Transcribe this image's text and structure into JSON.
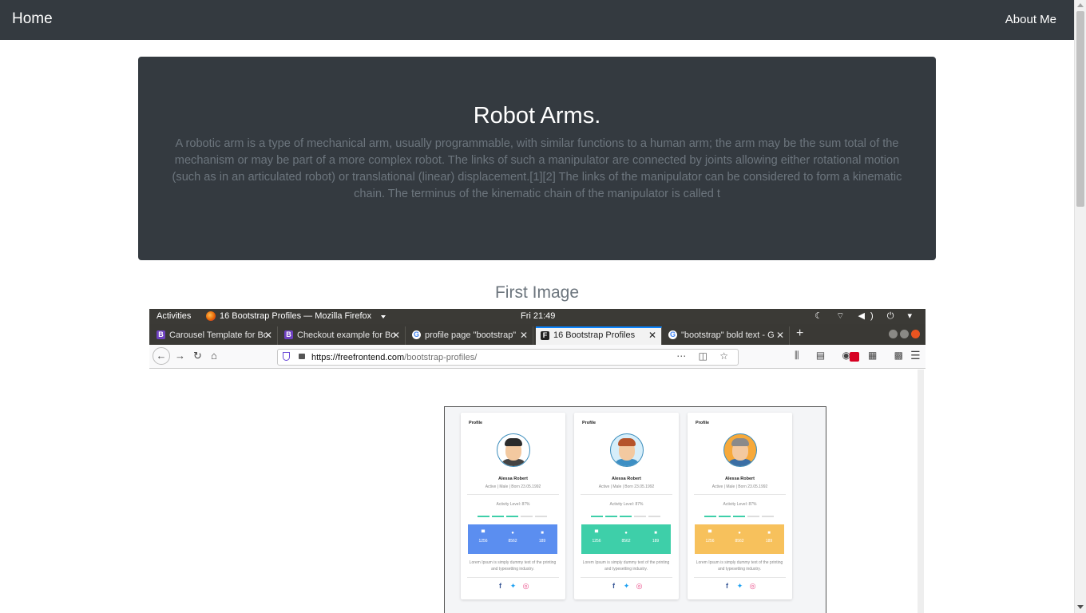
{
  "nav": {
    "home": "Home",
    "about": "About Me"
  },
  "jumbotron": {
    "title": "Robot Arms.",
    "text": "A robotic arm is a type of mechanical arm, usually programmable, with similar functions to a human arm; the arm may be the sum total of the mechanism or may be part of a more complex robot. The links of such a manipulator are connected by joints allowing either rotational motion (such as in an articulated robot) or translational (linear) displacement.[1][2] The links of the manipulator can be considered to form a kinematic chain. The terminus of the kinematic chain of the manipulator is called t"
  },
  "section": {
    "title": "First Image"
  },
  "screenshot": {
    "gnome": {
      "activities": "Activities",
      "app_title": "16 Bootstrap Profiles — Mozilla Firefox",
      "clock": "Fri 21:49"
    },
    "tabs": [
      {
        "label": "Carousel Template for Bo",
        "favicon": "B"
      },
      {
        "label": "Checkout example for Bo",
        "favicon": "B"
      },
      {
        "label": "profile page \"bootstrap\"",
        "favicon": "G"
      },
      {
        "label": "16 Bootstrap Profiles",
        "favicon": "F"
      },
      {
        "label": "\"bootstrap\" bold text - G",
        "favicon": "G"
      }
    ],
    "url": {
      "host": "https://freefrontend.com",
      "path": "/bootstrap-profiles/"
    },
    "cards": [
      {
        "label": "Profile",
        "name": "Alessa Robert",
        "sub": "Active | Male | Born 23.05.1992",
        "level": "Activity Level: 87%",
        "stats": [
          "1256",
          "8562",
          "189"
        ],
        "desc": "Lorem Ipsum is simply dummy text of the printing and typesetting industry.",
        "accent": "#5b8ef0",
        "hair": "#2b2b2b",
        "shirt": "#444"
      },
      {
        "label": "Profile",
        "name": "Alessa Robert",
        "sub": "Active | Male | Born 23.05.1992",
        "level": "Activity Level: 87%",
        "stats": [
          "1256",
          "8562",
          "189"
        ],
        "desc": "Lorem Ipsum is simply dummy text of the printing and typesetting industry.",
        "accent": "#3ecfa9",
        "hair": "#b5532a",
        "shirt": "#3d8fc4"
      },
      {
        "label": "Profile",
        "name": "Alessa Robert",
        "sub": "Active | Male | Born 23.05.1992",
        "level": "Activity Level: 87%",
        "stats": [
          "1256",
          "8562",
          "189"
        ],
        "desc": "Lorem Ipsum is simply dummy text of the printing and typesetting industry.",
        "accent": "#f7c15c",
        "hair": "#8a8a8a",
        "shirt": "#3a6ea5"
      }
    ],
    "social_colors": {
      "facebook": "#3b5998",
      "twitter": "#1da1f2",
      "dribbble": "#ea4c89"
    }
  }
}
